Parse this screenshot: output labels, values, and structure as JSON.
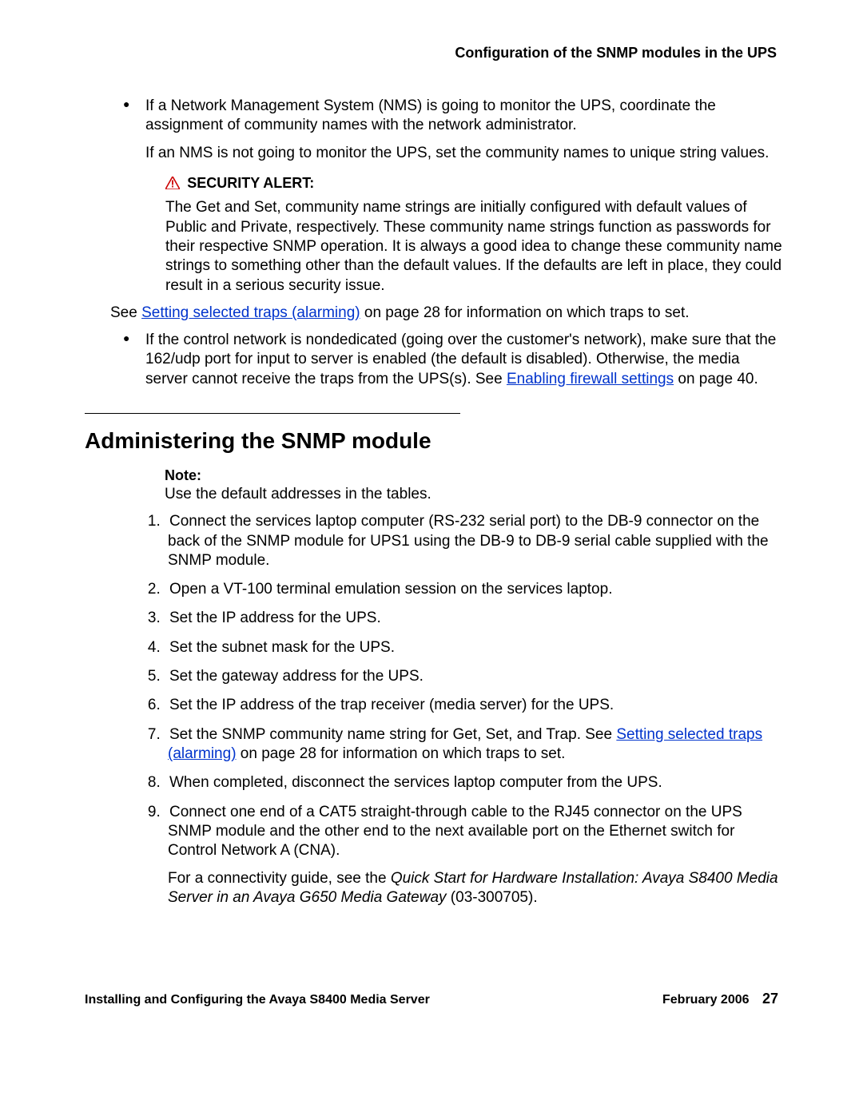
{
  "header": {
    "right_title": "Configuration of the SNMP modules in the UPS"
  },
  "bullet1": {
    "text_a": "If a Network Management System (NMS) is going to monitor the UPS, coordinate the assignment of community names with the network administrator.",
    "text_b": "If an NMS is not going to monitor the UPS, set the community names to unique string values."
  },
  "alert": {
    "label": "SECURITY ALERT:",
    "body": "The Get and Set, community name strings are initially configured with default values of Public and Private, respectively. These community name strings function as passwords for their respective SNMP operation. It is always a good idea to change these community name strings to something other than the default values. If the defaults are left in place, they could result in a serious security issue."
  },
  "see_line": {
    "pre": "See ",
    "link1": "Setting selected traps (alarming)",
    "post": " on page 28 for information on which traps to set."
  },
  "bullet2": {
    "text_pre": "If the control network is nondedicated (going over the customer's network), make sure that the 162/udp port for input to server is enabled (the default is disabled). Otherwise, the media server cannot receive the traps from the UPS(s). See ",
    "link": "Enabling firewall settings",
    "text_post": " on page 40."
  },
  "section": {
    "title": "Administering the SNMP module"
  },
  "note": {
    "label": "Note:",
    "body": "Use the default addresses in the tables."
  },
  "steps": [
    "Connect the services laptop computer (RS-232 serial port) to the DB-9 connector on the back of the SNMP module for UPS1 using the DB-9 to DB-9 serial cable supplied with the SNMP module.",
    "Open a VT-100 terminal emulation session on the services laptop.",
    "Set the IP address for the UPS.",
    "Set the subnet mask for the UPS.",
    "Set the gateway address for the UPS.",
    "Set the IP address of the trap receiver (media server) for the UPS."
  ],
  "step7": {
    "pre": "Set the SNMP community name string for Get, Set, and Trap. See ",
    "link": "Setting selected traps (alarming)",
    "post": " on page 28 for information on which traps to set."
  },
  "step8": "When completed, disconnect the services laptop computer from the UPS.",
  "step9": {
    "main": "Connect one end of a CAT5 straight-through cable to the RJ45 connector on the UPS SNMP module and the other end to the next available port on the Ethernet switch for Control Network A (CNA).",
    "sub_pre": "For a connectivity guide, see the ",
    "sub_italic": "Quick Start for Hardware Installation: Avaya S8400 Media Server in an Avaya G650 Media Gateway",
    "sub_post": " (03-300705)."
  },
  "footer": {
    "left": "Installing and Configuring the Avaya S8400 Media Server",
    "date": "February 2006",
    "page": "27"
  }
}
